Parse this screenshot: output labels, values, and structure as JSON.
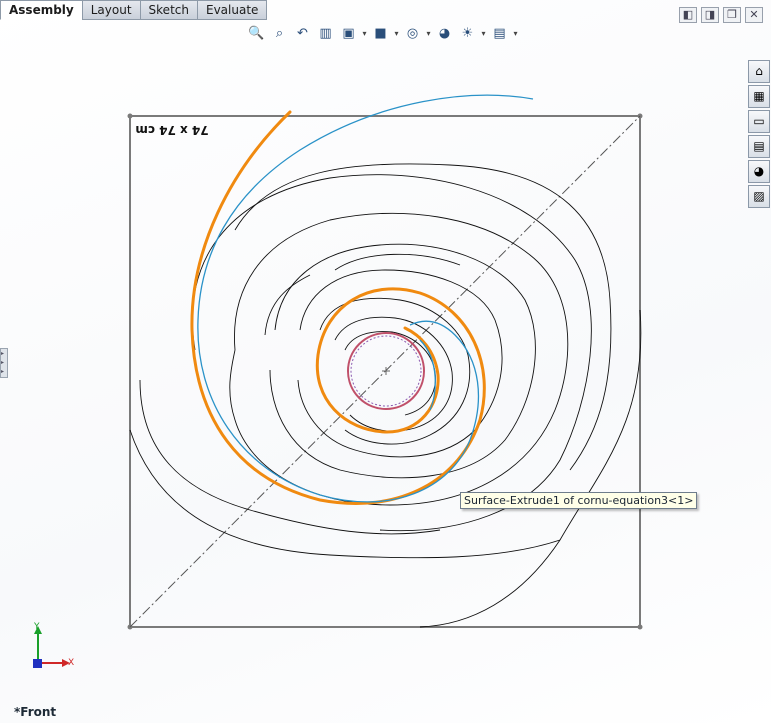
{
  "tabs": [
    {
      "label": "Assembly",
      "active": true
    },
    {
      "label": "Layout",
      "active": false
    },
    {
      "label": "Sketch",
      "active": false
    },
    {
      "label": "Evaluate",
      "active": false
    }
  ],
  "headsup_toolbar": {
    "icons": [
      "zoom-to-fit-icon",
      "zoom-to-area-icon",
      "previous-view-icon",
      "section-view-icon",
      "view-orientation-icon",
      "display-style-icon",
      "hide-show-items-icon",
      "edit-appearance-icon",
      "apply-scene-icon",
      "view-settings-icon"
    ]
  },
  "window_controls": [
    "tile-left-icon",
    "tile-right-icon",
    "restore-icon",
    "close-icon"
  ],
  "task_pane": [
    "home-icon",
    "design-library-icon",
    "file-explorer-icon",
    "view-palette-icon",
    "appearances-icon",
    "custom-properties-icon"
  ],
  "sketch": {
    "dimension_text": "74 x 74 cm",
    "colors": {
      "frame": "#7a7a7a",
      "curve": "#111111",
      "orange": "#f08a10",
      "blue": "#2a92c8",
      "circle": "#c0506a"
    }
  },
  "tooltip": {
    "text": "Surface-Extrude1 of cornu-equation3<1>"
  },
  "triad": {
    "x_label": "X",
    "y_label": "Y"
  },
  "view_name": "*Front"
}
